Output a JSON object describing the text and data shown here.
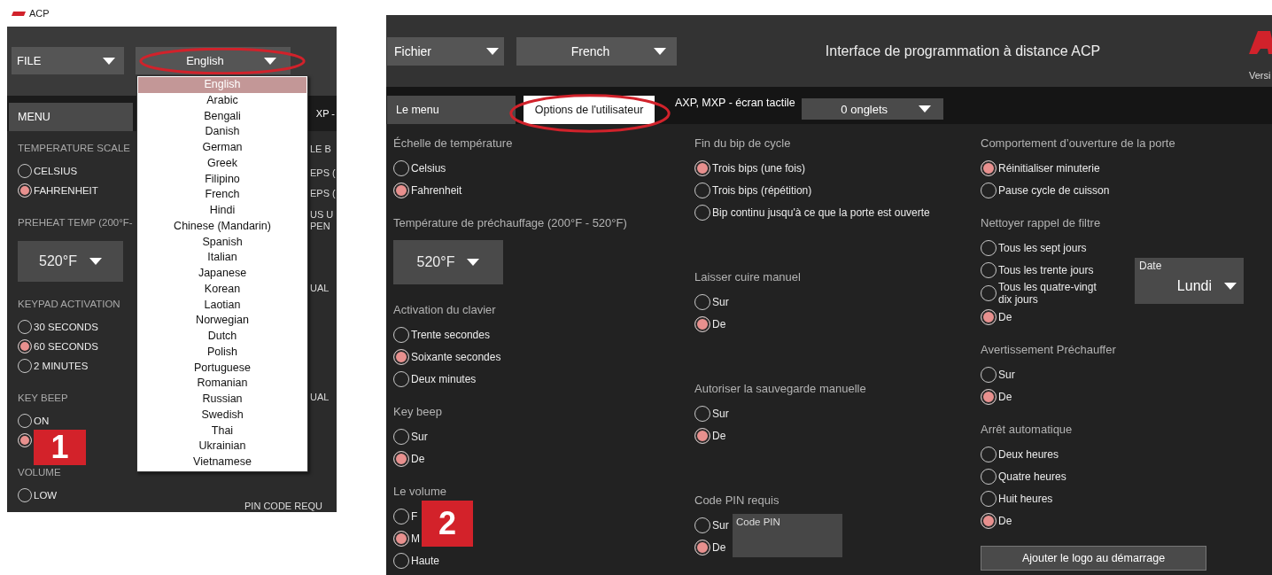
{
  "panels": [
    {
      "badge": "1",
      "window_title": "ACP",
      "file_menu": "FILE",
      "language_menu": "English",
      "language_menu_highlighted": true,
      "tabs": [
        {
          "label": "MENU",
          "selected": false
        }
      ],
      "tab_caption": "XP -",
      "columns": [
        {
          "groups": [
            {
              "kind": "radio",
              "heading": "TEMPERATURE SCALE",
              "options": [
                {
                  "label": "CELSIUS",
                  "selected": false
                },
                {
                  "label": "FAHRENHEIT",
                  "selected": true
                }
              ]
            },
            {
              "kind": "dropdown",
              "heading": "PREHEAT TEMP (200°F-",
              "value": "520°F"
            },
            {
              "kind": "radio",
              "heading": "KEYPAD ACTIVATION",
              "options": [
                {
                  "label": "30 SECONDS",
                  "selected": false
                },
                {
                  "label": "60 SECONDS",
                  "selected": true
                },
                {
                  "label": "2 MINUTES",
                  "selected": false
                }
              ]
            },
            {
              "kind": "radio",
              "heading": "KEY BEEP",
              "options": [
                {
                  "label": "ON",
                  "selected": false
                },
                {
                  "selected": true
                }
              ]
            },
            {
              "kind": "radio",
              "heading": "VOLUME",
              "options": [
                {
                  "label": "LOW",
                  "selected": false
                }
              ]
            }
          ]
        }
      ],
      "partial_texts": [
        "LE B",
        "EPS (",
        "EPS (",
        "US U",
        "PEN",
        "UAL",
        "UAL",
        "PIN CODE REQU"
      ],
      "language_list": [
        {
          "label": "English",
          "selected": true
        },
        {
          "label": "Arabic",
          "selected": false
        },
        {
          "label": "Bengali",
          "selected": false
        },
        {
          "label": "Danish",
          "selected": false
        },
        {
          "label": "German",
          "selected": false
        },
        {
          "label": "Greek",
          "selected": false
        },
        {
          "label": "Filipino",
          "selected": false
        },
        {
          "label": "French",
          "selected": false
        },
        {
          "label": "Hindi",
          "selected": false
        },
        {
          "label": "Chinese (Mandarin)",
          "selected": false
        },
        {
          "label": "Spanish",
          "selected": false
        },
        {
          "label": "Italian",
          "selected": false
        },
        {
          "label": "Japanese",
          "selected": false
        },
        {
          "label": "Korean",
          "selected": false
        },
        {
          "label": "Laotian",
          "selected": false
        },
        {
          "label": "Norwegian",
          "selected": false
        },
        {
          "label": "Dutch",
          "selected": false
        },
        {
          "label": "Polish",
          "selected": false
        },
        {
          "label": "Portuguese",
          "selected": false
        },
        {
          "label": "Romanian",
          "selected": false
        },
        {
          "label": "Russian",
          "selected": false
        },
        {
          "label": "Swedish",
          "selected": false
        },
        {
          "label": "Thai",
          "selected": false
        },
        {
          "label": "Ukrainian",
          "selected": false
        },
        {
          "label": "Vietnamese",
          "selected": false
        }
      ]
    },
    {
      "badge": "2",
      "file_menu": "Fichier",
      "language_menu": "French",
      "app_title": "Interface de programmation à distance ACP",
      "version_label": "Versi",
      "tabs": [
        {
          "label": "Le menu",
          "selected": false,
          "highlighted": false
        },
        {
          "label": "Options de l'utilisateur",
          "selected": true,
          "highlighted": true
        }
      ],
      "tab_caption": "AXP, MXP - écran tactile",
      "tabs_menu": "0 onglets",
      "columns": [
        {
          "groups": [
            {
              "kind": "radio",
              "heading": "Échelle de température",
              "options": [
                {
                  "label": "Celsius",
                  "selected": false
                },
                {
                  "label": "Fahrenheit",
                  "selected": true
                }
              ]
            },
            {
              "kind": "dropdown",
              "heading": "Température de préchauffage (200°F - 520°F)",
              "value": "520°F"
            },
            {
              "kind": "radio",
              "heading": "Activation du clavier",
              "options": [
                {
                  "label": "Trente secondes",
                  "selected": false
                },
                {
                  "label": "Soixante secondes",
                  "selected": true
                },
                {
                  "label": "Deux minutes",
                  "selected": false
                }
              ]
            },
            {
              "kind": "radio",
              "heading": "Key beep",
              "options": [
                {
                  "label": "Sur",
                  "selected": false
                },
                {
                  "label": "De",
                  "selected": true
                }
              ]
            },
            {
              "kind": "radio",
              "heading": "Le volume",
              "options": [
                {
                  "label": "F",
                  "selected": false
                },
                {
                  "label": "M",
                  "selected": true
                },
                {
                  "label": "Haute",
                  "selected": false
                }
              ]
            }
          ]
        },
        {
          "groups": [
            {
              "kind": "radio",
              "heading": "Fin du bip de cycle",
              "options": [
                {
                  "label": "Trois bips (une fois)",
                  "selected": true
                },
                {
                  "label": "Trois bips (répétition)",
                  "selected": false
                },
                {
                  "label": "Bip continu jusqu'à ce que la porte est ouverte",
                  "selected": false
                }
              ]
            },
            {
              "kind": "radio",
              "heading": "Laisser cuire manuel",
              "options": [
                {
                  "label": "Sur",
                  "selected": false
                },
                {
                  "label": "De",
                  "selected": true
                }
              ]
            },
            {
              "kind": "radio",
              "heading": "Autoriser la sauvegarde manuelle",
              "options": [
                {
                  "label": "Sur",
                  "selected": false
                },
                {
                  "label": "De",
                  "selected": true
                }
              ]
            },
            {
              "kind": "radio",
              "heading": "Code PIN requis",
              "options": [
                {
                  "label": "Sur",
                  "selected": false
                },
                {
                  "label": "De",
                  "selected": true
                }
              ],
              "field": {
                "placeholder": "Code PIN"
              }
            }
          ]
        },
        {
          "groups": [
            {
              "kind": "radio",
              "heading": "Comportement d’ouverture de la porte",
              "options": [
                {
                  "label": "Réinitialiser minuterie",
                  "selected": true
                },
                {
                  "label": "Pause cycle de cuisson",
                  "selected": false
                }
              ]
            },
            {
              "kind": "radio",
              "heading": "Nettoyer rappel de filtre",
              "options": [
                {
                  "label": "Tous les sept jours",
                  "selected": false
                },
                {
                  "label": "Tous les trente jours",
                  "selected": false
                },
                {
                  "label": "Tous les quatre-vingt dix jours",
                  "selected": false
                },
                {
                  "label": "De",
                  "selected": true
                }
              ],
              "menu": {
                "label": "Date",
                "value": "Lundi"
              }
            },
            {
              "kind": "radio",
              "heading": "Avertissement Préchauffer",
              "options": [
                {
                  "label": "Sur",
                  "selected": false
                },
                {
                  "label": "De",
                  "selected": true
                }
              ]
            },
            {
              "kind": "radio",
              "heading": "Arrêt automatique",
              "options": [
                {
                  "label": "Deux heures",
                  "selected": false
                },
                {
                  "label": "Quatre heures",
                  "selected": false
                },
                {
                  "label": "Huit heures",
                  "selected": false
                },
                {
                  "label": "De",
                  "selected": true
                }
              ]
            },
            {
              "kind": "button",
              "label": "Ajouter le logo au démarrage"
            }
          ]
        }
      ]
    }
  ]
}
